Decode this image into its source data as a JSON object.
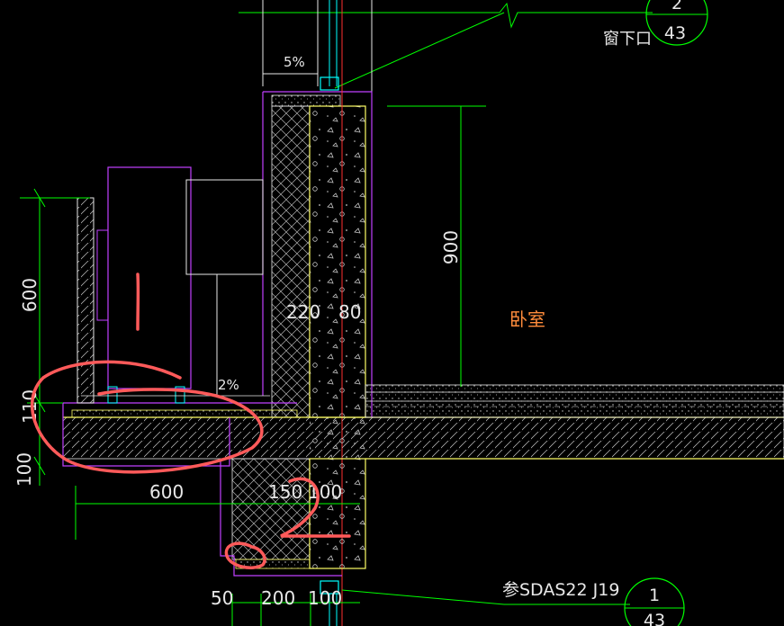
{
  "labels": {
    "top_slope": "5%",
    "ac_slope": "2%",
    "room": "卧室",
    "window_sill": "窗下口",
    "reference": "参SDAS22 J19",
    "dim_220": "220",
    "dim_80": "80",
    "dim_900": "900",
    "dim_600_v": "600",
    "dim_110": "110",
    "dim_100_v": "100",
    "dim_600_h": "600",
    "dim_150": "150",
    "dim_100_h": "100",
    "dim_50": "50",
    "dim_200": "200",
    "dim_100_b": "100",
    "callout_top_num": "2",
    "callout_top_den": "43",
    "callout_bot_num": "1",
    "callout_bot_den": "43",
    "handwritten_1": "1",
    "handwritten_2": "2"
  },
  "colors": {
    "background": "#000000",
    "magenta": "#c040ff",
    "yellow": "#ffff66",
    "green": "#00ff00",
    "white": "#e8e8e8",
    "red_axis": "#ff3030",
    "cyan": "#00ffff",
    "markup": "#ff5a5a",
    "room_text": "#ff8c3c"
  }
}
